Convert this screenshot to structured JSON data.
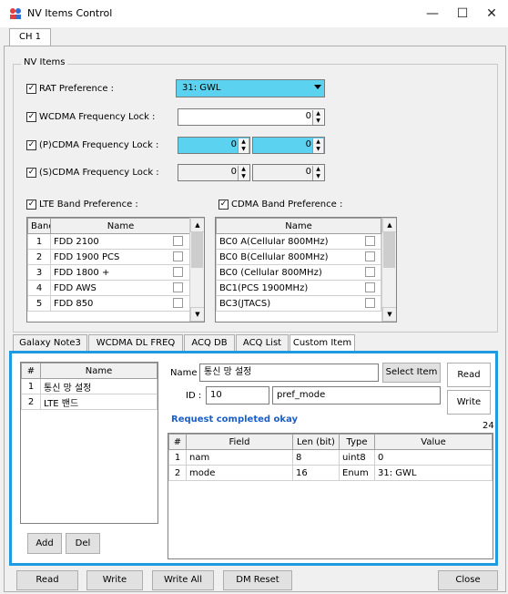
{
  "window": {
    "title": "NV Items Control",
    "minimize": "—",
    "maximize": "☐",
    "close": "✕"
  },
  "top_tab": "CH 1",
  "nv_items": {
    "legend": "NV Items",
    "rat_label": "RAT Preference :",
    "rat_value": "31: GWL",
    "wcdma_label": "WCDMA Frequency Lock :",
    "wcdma_value": "0",
    "pcdma_label": "(P)CDMA Frequency Lock :",
    "pcdma_value1": "0",
    "pcdma_value2": "0",
    "scdma_label": "(S)CDMA Frequency Lock :",
    "scdma_value1": "0",
    "scdma_value2": "0",
    "lte_label": "LTE Band Preference :",
    "cdma_label": "CDMA Band Preference :"
  },
  "lte_table": {
    "headers": [
      "Band",
      "Name"
    ],
    "rows": [
      {
        "band": "1",
        "name": "FDD 2100"
      },
      {
        "band": "2",
        "name": "FDD 1900 PCS"
      },
      {
        "band": "3",
        "name": "FDD 1800 +"
      },
      {
        "band": "4",
        "name": "FDD AWS"
      },
      {
        "band": "5",
        "name": "FDD 850"
      }
    ]
  },
  "cdma_table": {
    "header": "Name",
    "rows": [
      "BC0 A(Cellular 800MHz)",
      "BC0 B(Cellular 800MHz)",
      "BC0 (Cellular 800MHz)",
      "BC1(PCS 1900MHz)",
      "BC3(JTACS)"
    ]
  },
  "subtabs": [
    "Galaxy Note3",
    "WCDMA DL FREQ",
    "ACQ DB",
    "ACQ List",
    "Custom Item"
  ],
  "custom": {
    "list_headers": [
      "#",
      "Name"
    ],
    "list_rows": [
      {
        "num": "1",
        "name": "통신 망 설정"
      },
      {
        "num": "2",
        "name": "LTE 밴드"
      }
    ],
    "add": "Add",
    "del": "Del",
    "name_label": "Name :",
    "name_value": "통신 망 설정",
    "select_item": "Select Item",
    "read": "Read",
    "write": "Write",
    "id_label": "ID :",
    "id_value": "10",
    "id_name": "pref_mode",
    "status": "Request completed okay",
    "count": "24",
    "field_headers": [
      "#",
      "Field",
      "Len (bit)",
      "Type",
      "Value"
    ],
    "field_rows": [
      {
        "num": "1",
        "field": "nam",
        "len": "8",
        "type": "uint8",
        "value": "0"
      },
      {
        "num": "2",
        "field": "mode",
        "len": "16",
        "type": "Enum",
        "value": "31: GWL"
      }
    ]
  },
  "bottom_buttons": {
    "read": "Read",
    "write": "Write",
    "write_all": "Write All",
    "dm_reset": "DM Reset",
    "close": "Close"
  },
  "colors": {
    "accent": "#1e9be0",
    "highlight": "#5ad2f0",
    "status": "#1a5fc8"
  }
}
